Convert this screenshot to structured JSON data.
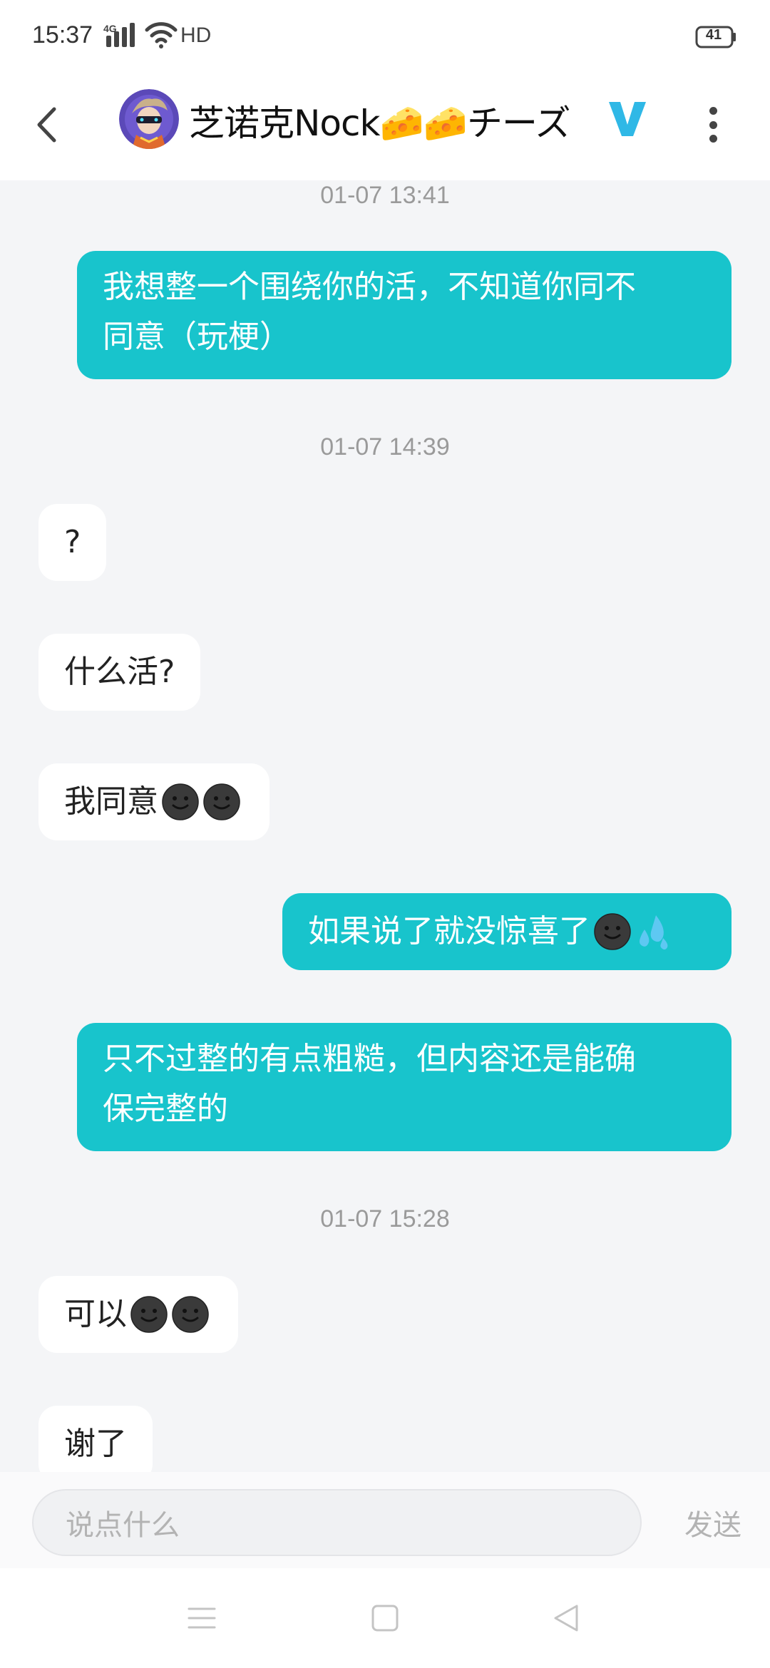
{
  "status_bar": {
    "time": "15:37",
    "network": "4G",
    "hd": "HD",
    "battery": "41"
  },
  "header": {
    "title": "芝诺克Nock🧀🧀チーズ",
    "badge": "V",
    "accent": "#2fb8e6"
  },
  "colors": {
    "sent_bubble": "#18c4cc",
    "received_bubble": "#ffffff",
    "background": "#f4f5f7"
  },
  "messages": [
    {
      "type": "time",
      "text": "01-07 13:41"
    },
    {
      "type": "sent",
      "line1": "我想整一个围绕你的活，不知道你同不",
      "line2": "同意（玩梗）"
    },
    {
      "type": "time",
      "text": "01-07 14:39"
    },
    {
      "type": "received",
      "text": "?"
    },
    {
      "type": "received",
      "text": "什么活?"
    },
    {
      "type": "received",
      "text": "我同意",
      "emojis": [
        "smiling-face-icon",
        "smiling-face-icon"
      ]
    },
    {
      "type": "sent",
      "text": "如果说了就没惊喜了",
      "emojis": [
        "smiling-face-icon",
        "sweat-droplets-icon"
      ]
    },
    {
      "type": "sent",
      "line1": "只不过整的有点粗糙，但内容还是能确",
      "line2": "保完整的"
    },
    {
      "type": "time",
      "text": "01-07 15:28"
    },
    {
      "type": "received",
      "text": "可以",
      "emojis": [
        "smiling-face-icon",
        "smiling-face-icon"
      ]
    },
    {
      "type": "received",
      "text": "谢了"
    }
  ],
  "input": {
    "placeholder": "说点什么",
    "send_label": "发送"
  }
}
